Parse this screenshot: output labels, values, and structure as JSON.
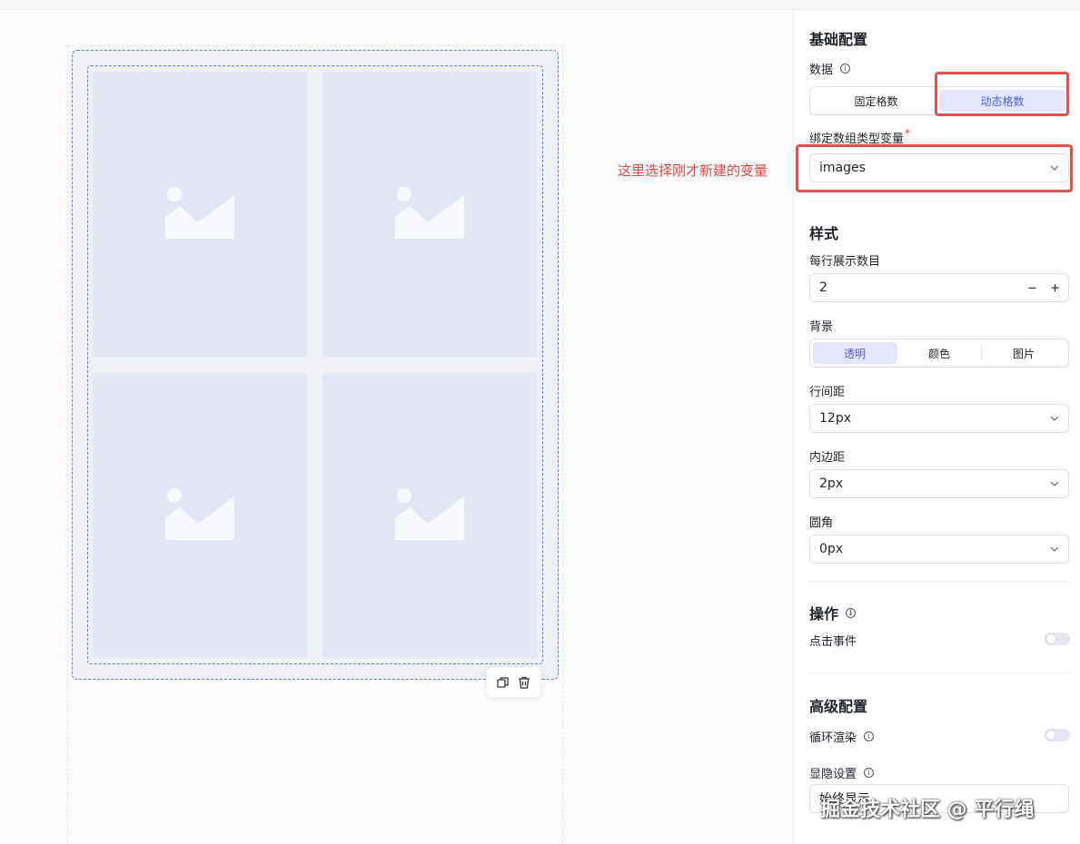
{
  "annotation": "这里选择刚才新建的变量",
  "basic": {
    "title": "基础配置",
    "data_label": "数据",
    "data_mode": {
      "options": [
        "固定格数",
        "动态格数"
      ],
      "selected": "动态格数"
    },
    "bind_label": "绑定数组类型变量",
    "bind_required": "*",
    "bind_value": "images"
  },
  "style": {
    "title": "样式",
    "per_row_label": "每行展示数目",
    "per_row_value": "2",
    "stepper_minus": "−",
    "stepper_plus": "+",
    "background_label": "背景",
    "background": {
      "options": [
        "透明",
        "颜色",
        "图片"
      ],
      "selected": "透明"
    },
    "row_gap_label": "行间距",
    "row_gap_value": "12px",
    "padding_label": "内边距",
    "padding_value": "2px",
    "radius_label": "圆角",
    "radius_value": "0px"
  },
  "action": {
    "title": "操作",
    "click_event_label": "点击事件",
    "click_event_enabled": false
  },
  "advanced": {
    "title": "高级配置",
    "loop_render_label": "循环渲染",
    "loop_render_enabled": false,
    "visibility_label": "显隐设置",
    "visibility_value": "始终显示"
  },
  "canvas": {
    "cells": [
      "image-placeholder",
      "image-placeholder",
      "image-placeholder",
      "image-placeholder"
    ],
    "toolbar_icons": [
      "copy-icon",
      "trash-icon"
    ]
  },
  "watermark": "掘金技术社区 @ 平行绳",
  "colors": {
    "accent": "#4d5ee5",
    "selection_border": "#5b7cf0",
    "annotation": "#e2453c",
    "placeholder_bg": "#e2e6f4"
  }
}
